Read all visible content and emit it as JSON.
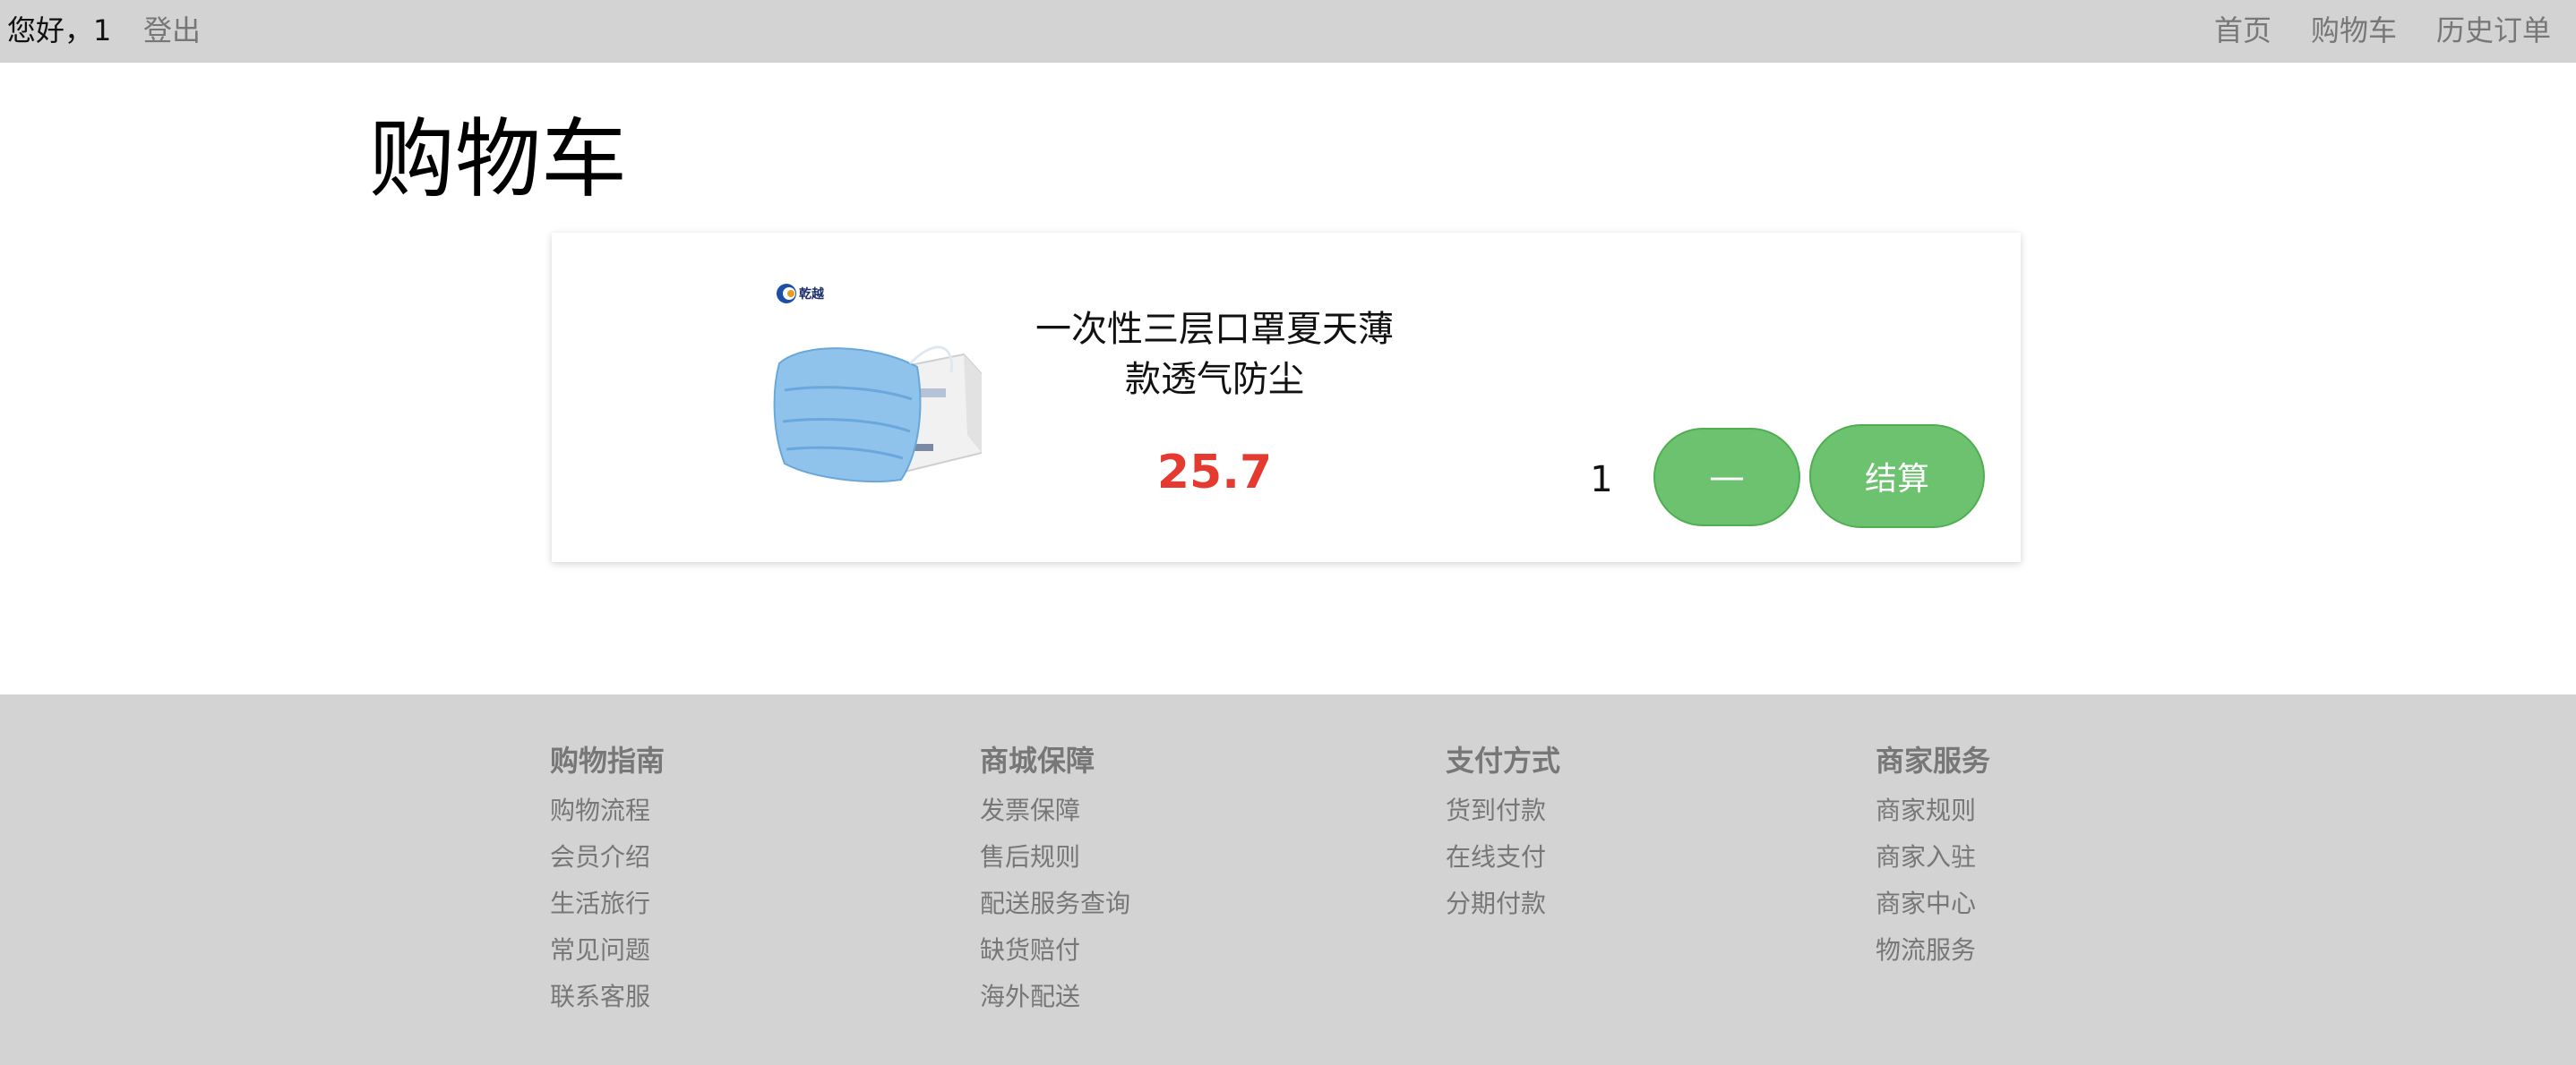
{
  "topbar": {
    "greeting": "您好，1",
    "logout": "登出",
    "nav": [
      "首页",
      "购物车",
      "历史订单"
    ]
  },
  "page_title": "购物车",
  "cart": {
    "item": {
      "name": "一次性三层口罩夏天薄款透气防尘",
      "price": "25.7",
      "quantity": "1",
      "image_brand_text": "乾越"
    },
    "minus_label": "—",
    "checkout_label": "结算"
  },
  "footer": {
    "columns": [
      {
        "title": "购物指南",
        "links": [
          "购物流程",
          "会员介绍",
          "生活旅行",
          "常见问题",
          "联系客服"
        ]
      },
      {
        "title": "商城保障",
        "links": [
          "发票保障",
          "售后规则",
          "配送服务查询",
          "缺货赔付",
          "海外配送"
        ]
      },
      {
        "title": "支付方式",
        "links": [
          "货到付款",
          "在线支付",
          "分期付款"
        ]
      },
      {
        "title": "商家服务",
        "links": [
          "商家规则",
          "商家入驻",
          "商家中心",
          "物流服务"
        ]
      }
    ]
  },
  "colors": {
    "topbar_bg": "#d3d3d3",
    "footer_bg": "#d3d3d3",
    "price": "#e53a2f",
    "button_green": "#6cc26f",
    "link_gray": "#777777"
  }
}
